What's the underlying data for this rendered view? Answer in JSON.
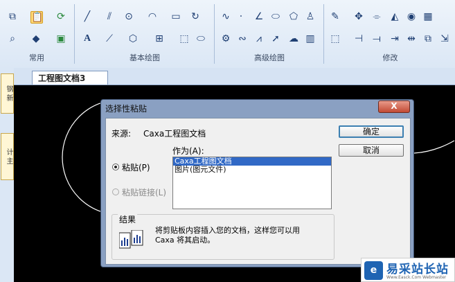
{
  "ribbon": {
    "groups": [
      {
        "label": "常用"
      },
      {
        "label": "基本绘图"
      },
      {
        "label": "高级绘图"
      },
      {
        "label": "修改"
      }
    ],
    "icons": {
      "copy": "⧉",
      "paste": "📋",
      "refresh": "⟳",
      "zoom": "⌕",
      "paint": "◆",
      "props": "▣",
      "line": "╱",
      "parallel": "⫽",
      "circle": "⊙",
      "arc": "◠",
      "rect": "▭",
      "redo_arc": "↻",
      "text": "A",
      "hatch_line": "⟋",
      "block": "⬡",
      "insert": "⊞",
      "frame": "⬚",
      "fillshape": "⬭",
      "spline": "∿",
      "dot": "·",
      "angle": "∠",
      "ellipse": "⬭",
      "polygon": "⬠",
      "figure": "♙",
      "gear": "⚙",
      "wave": "∾",
      "zigzag": "⩘",
      "arrow": "➚",
      "cloud": "☁",
      "bars": "▥",
      "brush": "✎",
      "move": "✥",
      "trim": "⌯",
      "mirror": "◭",
      "rotate": "◉",
      "array": "▦",
      "select": "⬚",
      "extend": "⊣",
      "break": "⟞",
      "export": "⇥",
      "stretch": "⇹",
      "copyobj": "⧉",
      "scale": "⇲"
    }
  },
  "side_tabs": [
    "钢 新",
    "计 主"
  ],
  "doc_tab": {
    "title": "工程图文档3"
  },
  "dialog": {
    "title": "选择性粘贴",
    "close_symbol": "X",
    "source_label": "来源:",
    "source_value": "Caxa工程图文档",
    "as_label": "作为(A):",
    "options": [
      "粘贴(P)",
      "粘贴链接(L)"
    ],
    "list_items": [
      "Caxa工程图文档",
      "图片(图元文件)"
    ],
    "selected_index": 0,
    "ok": "确定",
    "cancel": "取消",
    "result_label": "结果",
    "result_text_1": "将剪贴板内容插入您的文档，这样您可以用",
    "result_text_2": "Caxa 将其启动。"
  },
  "watermark": {
    "logo": "e",
    "name": "易采站长站",
    "sub": "Www.Easck.Com Webmaster"
  }
}
